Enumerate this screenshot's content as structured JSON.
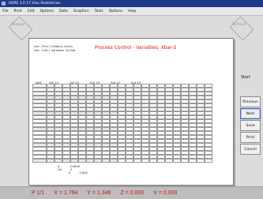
{
  "window": {
    "title": "UGRE 3.0 17 Visu Statistician"
  },
  "menu": [
    "File",
    "Print",
    "Edit",
    "Options",
    "Data",
    "Graphics",
    "Tools",
    "Options",
    "Help"
  ],
  "watermark": {
    "left": "Terminal",
    "right": "Terminal"
  },
  "sheet": {
    "notes": [
      "Use - Find 1 Editions Licens",
      "Use - Edit 1 Variables 16-Stat"
    ],
    "title": "Process Control - Variables, Xbar-S",
    "grid_header": [
      "Date",
      "Suit 1/1",
      "Suit 1/2",
      "Suit 1/3",
      "Suit 2/1",
      "Suit 2/2"
    ],
    "stats": [
      "S",
      "Ok",
      "2",
      "0",
      "0.0000",
      "0.000"
    ]
  },
  "side": {
    "label": "Start",
    "buttons": [
      "Previous",
      "Next",
      "Save",
      "Print",
      "Cancel"
    ]
  },
  "status": {
    "page": "P 1/1",
    "x": "X = 1.794",
    "y": "Y = 1.346",
    "z": "Z = 0.000",
    "v": "V = 0.000"
  }
}
